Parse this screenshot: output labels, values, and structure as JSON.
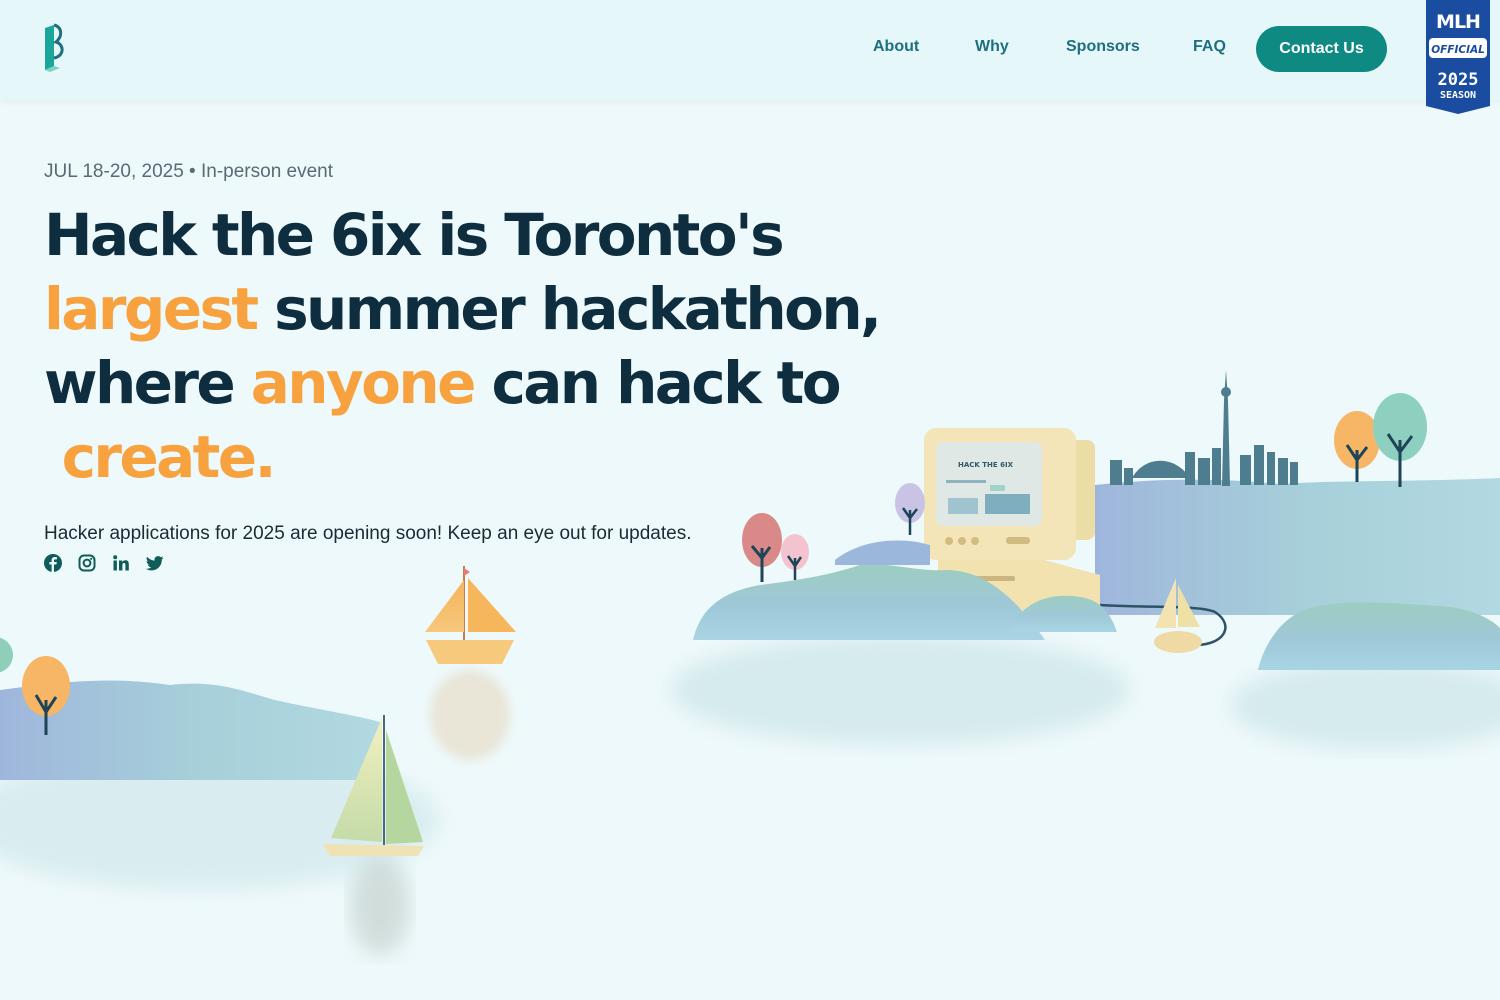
{
  "nav": {
    "logo_name": "hack-the-6ix-logo",
    "links": [
      "About",
      "Why",
      "Sponsors",
      "FAQ"
    ],
    "contact_label": "Contact Us"
  },
  "badge": {
    "title": "MLH",
    "label": "OFFICIAL",
    "year": "2025",
    "season": "SEASON"
  },
  "hero": {
    "event_info": "JUL 18-20, 2025 • In-person event",
    "headline": {
      "line1": "Hack the 6ix is Toronto's",
      "line2_accent": "largest",
      "line2_rest": " summer hackathon,",
      "line3_start": "where ",
      "line3_accent": "anyone",
      "line3_rest": " can hack to",
      "line4_accent": " create."
    },
    "tagline": "Hacker applications for 2025 are opening soon! Keep an eye out for updates."
  },
  "socials": [
    "facebook-icon",
    "instagram-icon",
    "linkedin-icon",
    "twitter-icon"
  ],
  "screen_text": {
    "title": "HACK THE 6IX"
  },
  "colors": {
    "accent_orange": "#f7a23f",
    "headline_dark": "#0e2e3f",
    "brand_teal": "#0e8a83",
    "nav_link": "#1f6f80",
    "background": "#eef9fb",
    "mlh_blue": "#1a4da0"
  }
}
